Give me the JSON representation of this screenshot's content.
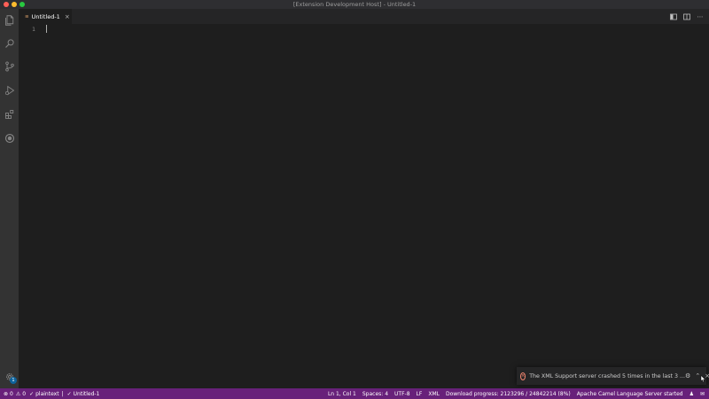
{
  "window": {
    "title": "[Extension Development Host] - Untitled-1"
  },
  "activity_bar": {
    "items": [
      {
        "icon": "files-icon"
      },
      {
        "icon": "search-icon"
      },
      {
        "icon": "source-control-icon"
      },
      {
        "icon": "run-debug-icon"
      },
      {
        "icon": "extensions-icon"
      },
      {
        "icon": "extension-custom-icon"
      }
    ],
    "manage_badge": "1"
  },
  "tabs": [
    {
      "label": "Untitled-1",
      "icon": "plaintext-file-icon"
    }
  ],
  "editor": {
    "line_numbers": [
      "1"
    ]
  },
  "notification": {
    "message": "The XML Support server crashed 5 times in the last 3 ...",
    "severity_color": "#f48771"
  },
  "status_bar": {
    "background": "#68217a",
    "errors": "0",
    "warnings": "0",
    "language_check": "plaintext",
    "file_check": "Untitled-1",
    "cursor_position": "Ln 1, Col 1",
    "indentation": "Spaces: 4",
    "encoding": "UTF-8",
    "eol": "LF",
    "language_mode": "XML",
    "download_progress": "Download progress: 2123296 / 24842214 (8%)",
    "server_status": "Apache Camel Language Server started"
  }
}
